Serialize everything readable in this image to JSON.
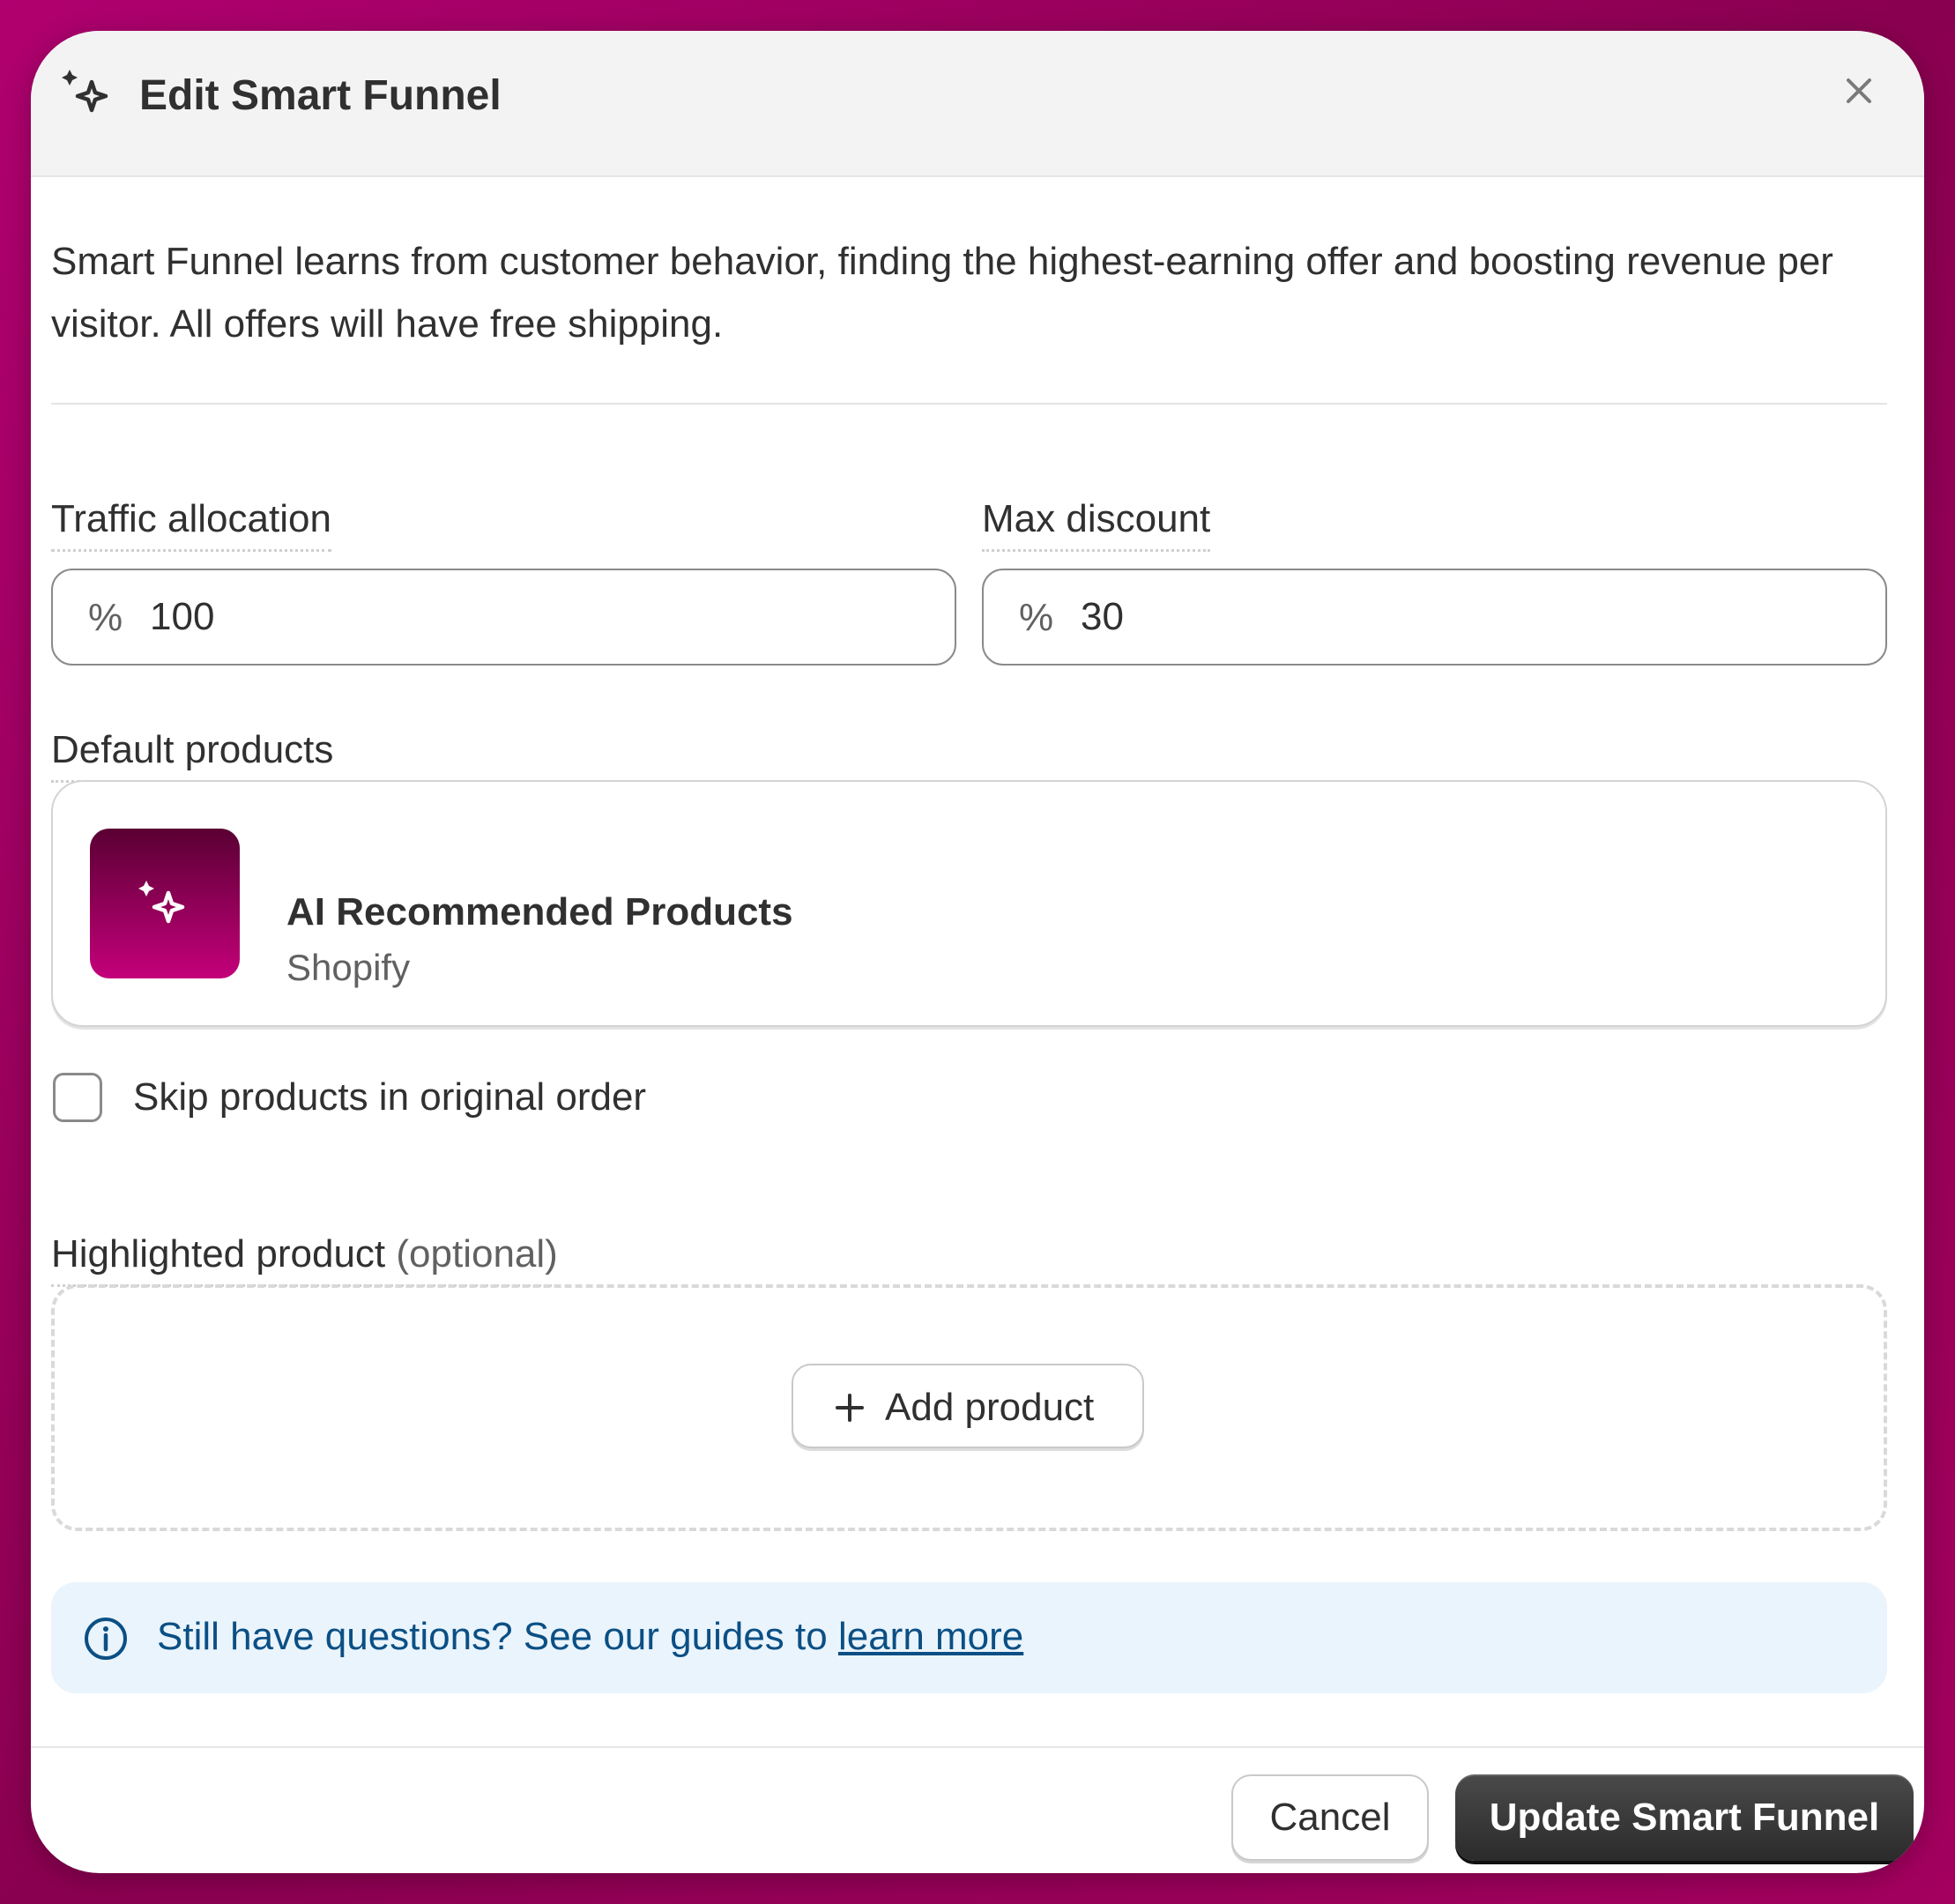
{
  "dialog": {
    "title": "Edit Smart Funnel",
    "title_icon": "sparkle-icon",
    "close_icon": "close-icon",
    "description": "Smart Funnel learns from customer behavior, finding the highest-earning offer and boosting revenue per visitor. All offers will have free shipping."
  },
  "form": {
    "traffic_allocation": {
      "label": "Traffic allocation",
      "prefix": "%",
      "value": "100"
    },
    "max_discount": {
      "label": "Max discount",
      "prefix": "%",
      "value": "30"
    },
    "default_products": {
      "label": "Default products",
      "product": {
        "name": "AI Recommended Products",
        "vendor": "Shopify",
        "icon": "sparkle-icon"
      }
    },
    "skip_products": {
      "label": "Skip products in original order",
      "checked": false
    },
    "highlighted_product": {
      "label": "Highlighted product",
      "optional": "(optional)",
      "add_button": "Add product"
    }
  },
  "banner": {
    "text": "Still have questions? See our guides to ",
    "link": "learn more",
    "icon": "info-icon"
  },
  "footer": {
    "cancel_label": "Cancel",
    "primary_label": "Update Smart Funnel"
  },
  "colors": {
    "background": "#a3005f",
    "primary_button": "#303030",
    "banner_bg": "#eaf4fc",
    "banner_text": "#0b4f84"
  }
}
